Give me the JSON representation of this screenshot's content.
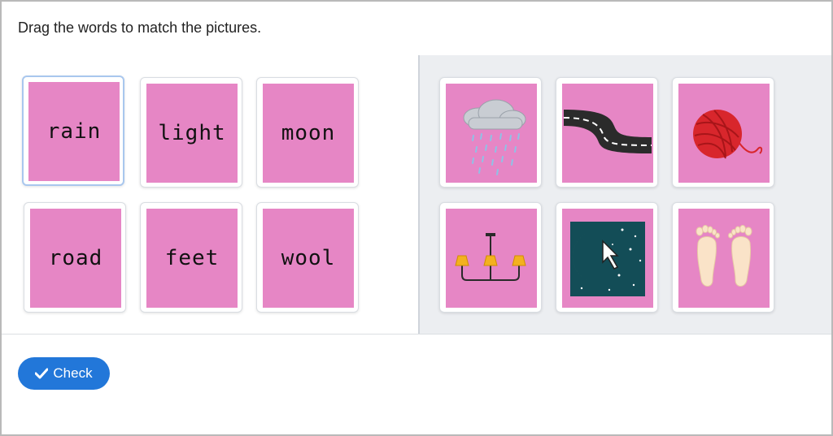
{
  "instruction": "Drag the words to match the pictures.",
  "words": [
    {
      "label": "rain"
    },
    {
      "label": "light"
    },
    {
      "label": "moon"
    },
    {
      "label": "road"
    },
    {
      "label": "feet"
    },
    {
      "label": "wool"
    }
  ],
  "pictures": [
    {
      "icon": "rain-cloud-icon"
    },
    {
      "icon": "road-icon"
    },
    {
      "icon": "wool-ball-icon"
    },
    {
      "icon": "chandelier-light-icon"
    },
    {
      "icon": "moon-night-icon"
    },
    {
      "icon": "feet-icon"
    }
  ],
  "check_button": {
    "label": "Check",
    "icon": "checkmark-icon"
  },
  "colors": {
    "card_fill": "#e686c5",
    "button": "#2277d9",
    "right_pane": "#eceef1"
  }
}
